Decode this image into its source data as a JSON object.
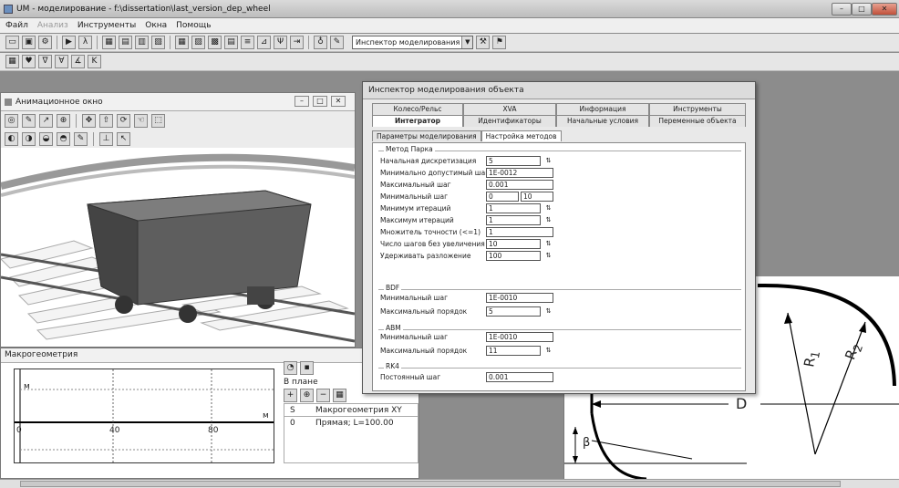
{
  "window": {
    "title": "UM - моделирование - f:\\dissertation\\last_version_dep_wheel"
  },
  "menu": [
    {
      "label": "Файл",
      "enabled": true
    },
    {
      "label": "Анализ",
      "enabled": false
    },
    {
      "label": "Инструменты",
      "enabled": true
    },
    {
      "label": "Окна",
      "enabled": true
    },
    {
      "label": "Помощь",
      "enabled": true
    }
  ],
  "toolbar": {
    "combo_value": "Инспектор моделирования"
  },
  "anim_window": {
    "title": "Анимационное окно"
  },
  "macro_window": {
    "title": "Макрогеометрия",
    "axis_label_y": "м",
    "axis_label_x": "м",
    "x_ticks": [
      "0",
      "40",
      "80"
    ],
    "view_label": "В плане",
    "table_headers": [
      "S",
      "Макрогеометрия XY"
    ],
    "table_rows": [
      [
        "0",
        "Прямая; L=100.00"
      ]
    ]
  },
  "inspector": {
    "title": "Инспектор моделирования объекта",
    "tabs_row1": [
      "Колесо/Рельс",
      "XVA",
      "Информация",
      "Инструменты"
    ],
    "tabs_row2": [
      "Интегратор",
      "Идентификаторы",
      "Начальные условия",
      "Переменные объекта"
    ],
    "subtabs": [
      "Параметры моделирования",
      "Настройка методов"
    ],
    "park": {
      "group": "Метод Парка",
      "fields": [
        {
          "label": "Начальная дискретизация",
          "value": "5"
        },
        {
          "label": "Минимально допустимый шаг",
          "value": "1E-0012"
        },
        {
          "label": "Максимальный шаг",
          "value": "0.001"
        },
        {
          "label": "Минимальный шаг",
          "value": "0",
          "value2": "10"
        },
        {
          "label": "Минимум итераций",
          "value": "1"
        },
        {
          "label": "Максимум итераций",
          "value": "1"
        },
        {
          "label": "Множитель точности (<=1)",
          "value": "1"
        },
        {
          "label": "Число шагов без увеличения",
          "value": "10"
        },
        {
          "label": "Удерживать разложение",
          "value": "100"
        }
      ]
    },
    "bdf": {
      "group": "BDF",
      "fields": [
        {
          "label": "Минимальный шаг",
          "value": "1E-0010"
        },
        {
          "label": "Максимальный порядок",
          "value": "5"
        }
      ]
    },
    "abm": {
      "group": "ABM",
      "fields": [
        {
          "label": "Минимальный шаг",
          "value": "1E-0010"
        },
        {
          "label": "Максимальный порядок",
          "value": "11"
        }
      ]
    },
    "rk4": {
      "group": "RK4",
      "fields": [
        {
          "label": "Постоянный шаг",
          "value": "0.001"
        }
      ]
    }
  },
  "profile": {
    "label_d": "D",
    "label_beta": "β",
    "label_r1": "R",
    "label_r2": "R",
    "sub_r1": "1",
    "sub_r2": "2"
  }
}
